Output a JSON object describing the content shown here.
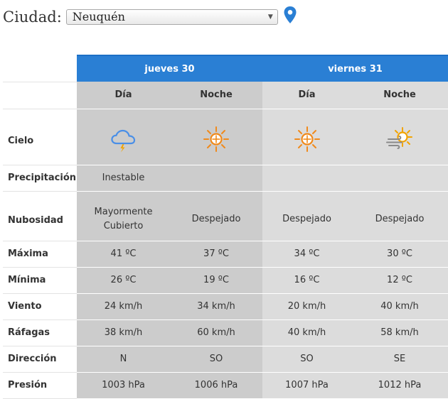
{
  "location": {
    "label": "Ciudad:",
    "selected_city": "Neuquén",
    "pin_icon": "map-pin-icon",
    "pin_color": "#2a7fd4"
  },
  "forecast": {
    "header_color": "#2a7fd4",
    "days": [
      {
        "label": "jueves 30",
        "periods": [
          "Día",
          "Noche"
        ]
      },
      {
        "label": "viernes 31",
        "periods": [
          "Día",
          "Noche"
        ]
      }
    ],
    "rows": {
      "cielo": {
        "label": "Cielo",
        "icons": [
          "cloud-storm-icon",
          "sun-icon",
          "sun-icon",
          "sun-wind-icon"
        ]
      },
      "precipitacion": {
        "label": "Precipitación",
        "values": [
          "Inestable",
          "",
          "",
          ""
        ]
      },
      "nubosidad": {
        "label": "Nubosidad",
        "values": [
          "Mayormente Cubierto",
          "Despejado",
          "Despejado",
          "Despejado"
        ]
      },
      "maxima": {
        "label": "Máxima",
        "values": [
          "41 ºC",
          "37 ºC",
          "34 ºC",
          "30 ºC"
        ]
      },
      "minima": {
        "label": "Mínima",
        "values": [
          "26 ºC",
          "19 ºC",
          "16 ºC",
          "12 ºC"
        ]
      },
      "viento": {
        "label": "Viento",
        "values": [
          "24 km/h",
          "34 km/h",
          "20 km/h",
          "40 km/h"
        ]
      },
      "rafagas": {
        "label": "Ráfagas",
        "values": [
          "38 km/h",
          "60 km/h",
          "40 km/h",
          "58 km/h"
        ]
      },
      "direccion": {
        "label": "Dirección",
        "values": [
          "N",
          "SO",
          "SO",
          "SE"
        ]
      },
      "presion": {
        "label": "Presión",
        "values": [
          "1003 hPa",
          "1006 hPa",
          "1007 hPa",
          "1012 hPa"
        ]
      }
    }
  }
}
